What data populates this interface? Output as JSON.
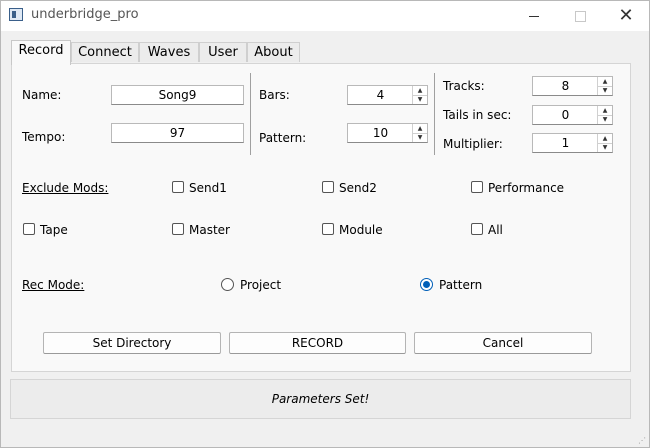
{
  "window": {
    "title": "underbridge_pro"
  },
  "tabs": [
    {
      "label": "Record"
    },
    {
      "label": "Connect"
    },
    {
      "label": "Waves"
    },
    {
      "label": "User"
    },
    {
      "label": "About"
    }
  ],
  "record": {
    "name": {
      "label": "Name:",
      "value": "Song9"
    },
    "tempo": {
      "label": "Tempo:",
      "value": "97"
    },
    "bars": {
      "label": "Bars:",
      "value": "4"
    },
    "pattern": {
      "label": "Pattern:",
      "value": "10"
    },
    "tracks": {
      "label": "Tracks:",
      "value": "8"
    },
    "tails": {
      "label": "Tails in sec:",
      "value": "0"
    },
    "multiplier": {
      "label": "Multiplier:",
      "value": "1"
    },
    "exclude_mods": {
      "label": "Exclude Mods:",
      "options": [
        {
          "label": "Send1",
          "checked": false
        },
        {
          "label": "Send2",
          "checked": false
        },
        {
          "label": "Performance",
          "checked": false
        },
        {
          "label": "Tape",
          "checked": false
        },
        {
          "label": "Master",
          "checked": false
        },
        {
          "label": "Module",
          "checked": false
        },
        {
          "label": "All",
          "checked": false
        }
      ]
    },
    "rec_mode": {
      "label": "Rec Mode:",
      "options": [
        {
          "label": "Project",
          "selected": false
        },
        {
          "label": "Pattern",
          "selected": true
        }
      ]
    },
    "buttons": {
      "set_directory": "Set Directory",
      "record": "RECORD",
      "cancel": "Cancel"
    }
  },
  "status": "Parameters Set!",
  "colors": {
    "accent": "#005fb8",
    "background": "#f0f0f0",
    "panel": "#f9f9f9"
  }
}
